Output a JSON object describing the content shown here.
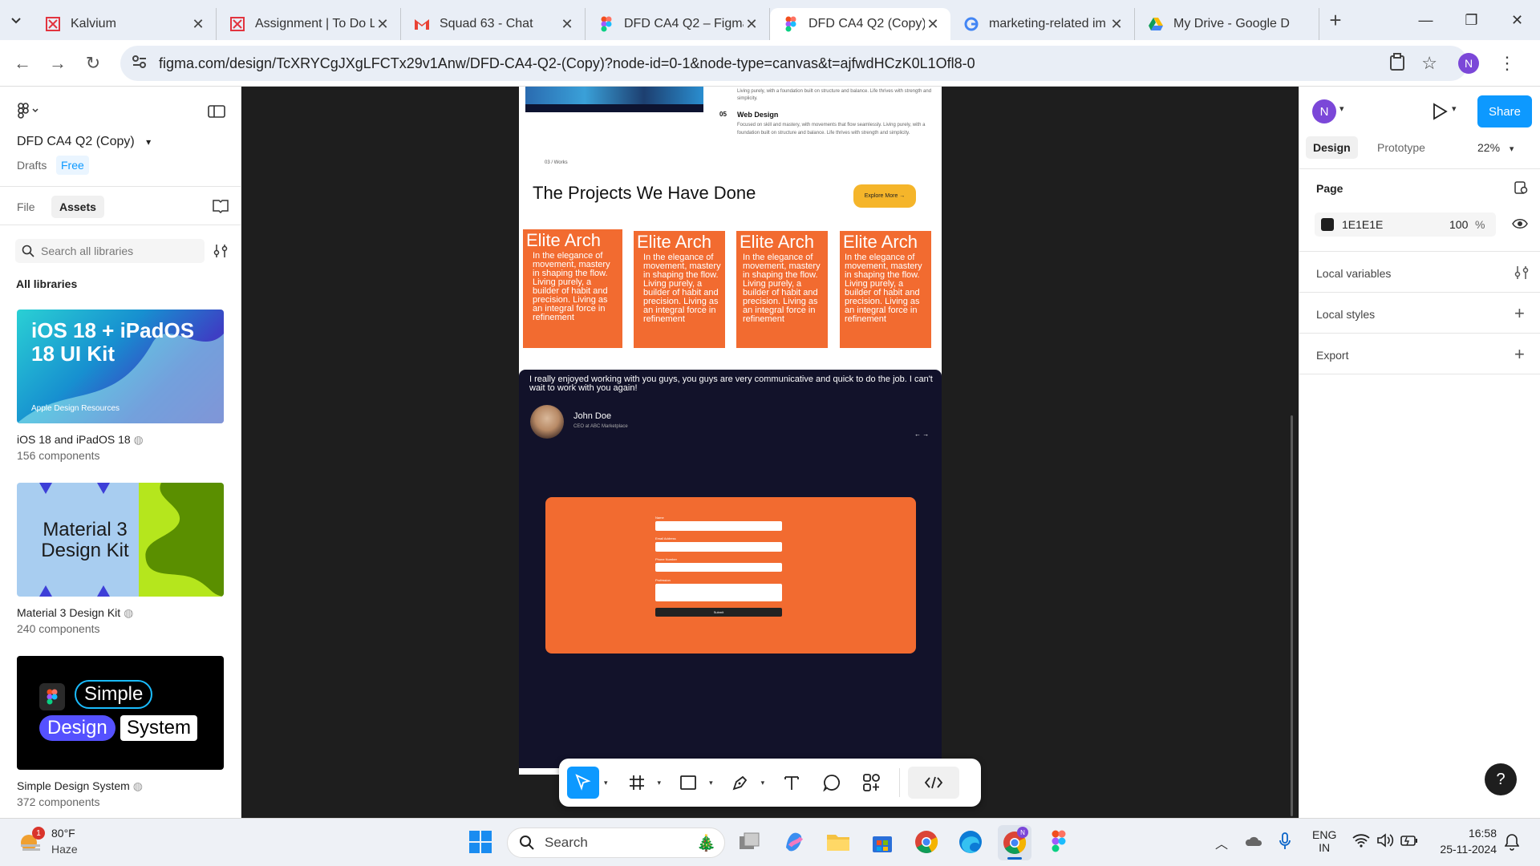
{
  "browser": {
    "tabs": [
      {
        "title": "Kalvium",
        "icon": "kalvium-icon"
      },
      {
        "title": "Assignment | To Do L",
        "icon": "kalvium-icon"
      },
      {
        "title": "Squad 63 - Chat",
        "icon": "gmail-icon"
      },
      {
        "title": "DFD CA4 Q2 – Figma",
        "icon": "figma-icon"
      },
      {
        "title": "DFD CA4 Q2 (Copy) -",
        "icon": "figma-icon"
      },
      {
        "title": "marketing-related im",
        "icon": "google-icon"
      },
      {
        "title": "My Drive - Google D",
        "icon": "drive-icon"
      }
    ],
    "url": "figma.com/design/TcXRYCgJXgLFCTx29v1Anw/DFD-CA4-Q2-(Copy)?node-id=0-1&node-type=canvas&t=ajfwdHCzK0L1Ofl8-0",
    "profile_initial": "N"
  },
  "left_panel": {
    "file_name": "DFD CA4 Q2 (Copy)",
    "location": "Drafts",
    "plan": "Free",
    "tabs": [
      "File",
      "Assets"
    ],
    "search_placeholder": "Search all libraries",
    "section_title": "All libraries",
    "libraries": [
      {
        "name": "iOS 18 and iPadOS 18",
        "count": "156 components",
        "thumb_title": "iOS 18 + iPadOS 18 UI Kit",
        "thumb_sub": "Apple Design Resources"
      },
      {
        "name": "Material 3 Design Kit",
        "count": "240 components",
        "thumb_title": "Material 3 Design Kit"
      },
      {
        "name": "Simple Design System",
        "count": "372 components",
        "thumb_words": [
          "Simple",
          "Design",
          "System"
        ]
      }
    ]
  },
  "right_panel": {
    "avatar": "N",
    "share_label": "Share",
    "tabs": [
      "Design",
      "Prototype"
    ],
    "zoom": "22%",
    "page_label": "Page",
    "page_color": "1E1E1E",
    "page_opacity": "100",
    "page_opacity_unit": "%",
    "rows": [
      "Local variables",
      "Local styles",
      "Export"
    ],
    "help": "?"
  },
  "design": {
    "services": [
      {
        "num": "",
        "title": "",
        "desc": "Living purely, with a foundation built on structure and balance. Life thrives with strength and simplicity."
      },
      {
        "num": "05",
        "title": "Web Design",
        "desc": "Focused on skill and mastery, with movements that flow seamlessly. Living purely, with a foundation built on structure and balance. Life thrives with strength and simplicity."
      }
    ],
    "works_label": "03 / Works",
    "projects_heading": "The Projects We Have Done",
    "explore_label": "Explore More →",
    "cards": [
      {
        "title": "Elite Arch",
        "text": "In the elegance of movement, mastery in shaping the flow. Living purely, a builder of habit and precision. Living as an integral force in refinement"
      },
      {
        "title": "Elite Arch",
        "text": "In the elegance of movement, mastery in shaping the flow. Living purely, a builder of habit and precision. Living as an integral force in refinement"
      },
      {
        "title": "Elite Arch",
        "text": "In the elegance of movement, mastery in shaping the flow. Living purely, a builder of habit and precision. Living as an integral force in refinement"
      },
      {
        "title": "Elite Arch",
        "text": "In the elegance of movement, mastery in shaping the flow. Living purely, a builder of habit and precision. Living as an integral force in refinement"
      }
    ],
    "testimonial": "I really enjoyed working with you guys, you guys are very communicative and quick to do the job. I can't wait to work with you again!",
    "person_name": "John Doe",
    "person_role": "CEO at ABC Marketplace",
    "arrows": "← →",
    "form_labels": [
      "Name",
      "Email Address",
      "Phone Number",
      "Profession"
    ],
    "form_submit": "Submit"
  },
  "taskbar": {
    "temp": "80°F",
    "weather": "Haze",
    "weather_badge": "1",
    "search": "Search",
    "lang1": "ENG",
    "lang2": "IN",
    "time": "16:58",
    "date": "25-11-2024"
  },
  "colors": {
    "accent": "#0d99ff",
    "orange": "#f26b30",
    "dark": "#12122a",
    "yellow": "#f5b52a"
  }
}
